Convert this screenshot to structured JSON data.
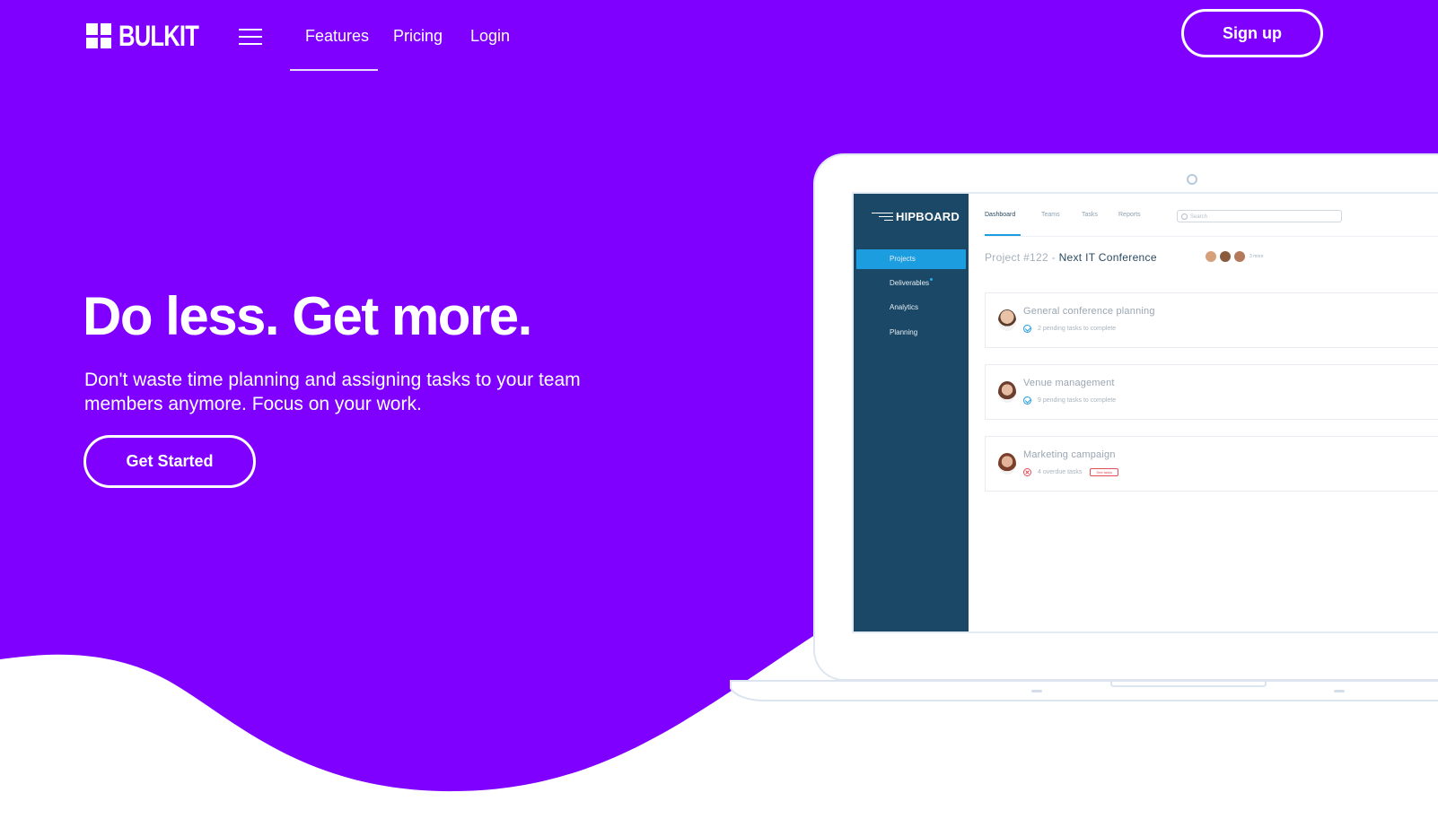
{
  "brand": {
    "name": "BULKIT"
  },
  "nav": {
    "links": [
      {
        "label": "Features",
        "active": true
      },
      {
        "label": "Pricing"
      },
      {
        "label": "Login"
      }
    ],
    "signup_label": "Sign up"
  },
  "hero": {
    "title": "Do less. Get more.",
    "subtitle": "Don't waste time planning and assigning tasks to your team members anymore. Focus on your work.",
    "cta_label": "Get Started"
  },
  "colors": {
    "primary": "#7f00ff",
    "app_sidebar": "#1b4866",
    "app_accent": "#1c9de0"
  },
  "mockup": {
    "app_name": "HIPBOARD",
    "sidebar_items": [
      {
        "label": "Projects",
        "active": true
      },
      {
        "label": "Deliverables",
        "has_dot": true
      },
      {
        "label": "Analytics"
      },
      {
        "label": "Planning"
      }
    ],
    "tabs": [
      {
        "label": "Dashboard",
        "active": true
      },
      {
        "label": "Teams"
      },
      {
        "label": "Tasks"
      },
      {
        "label": "Reports"
      }
    ],
    "search_placeholder": "Search",
    "project": {
      "prefix": "Project #122 -",
      "name": "Next IT Conference",
      "more": "3 more"
    },
    "cards": [
      {
        "title": "General conference planning",
        "status": "2 pending tasks to complete",
        "state": "ok"
      },
      {
        "title": "Venue management",
        "status": "9 pending tasks to complete",
        "state": "ok"
      },
      {
        "title": "Marketing campaign",
        "status": "4 overdue tasks",
        "state": "overdue",
        "tag": "See tasks"
      }
    ]
  }
}
